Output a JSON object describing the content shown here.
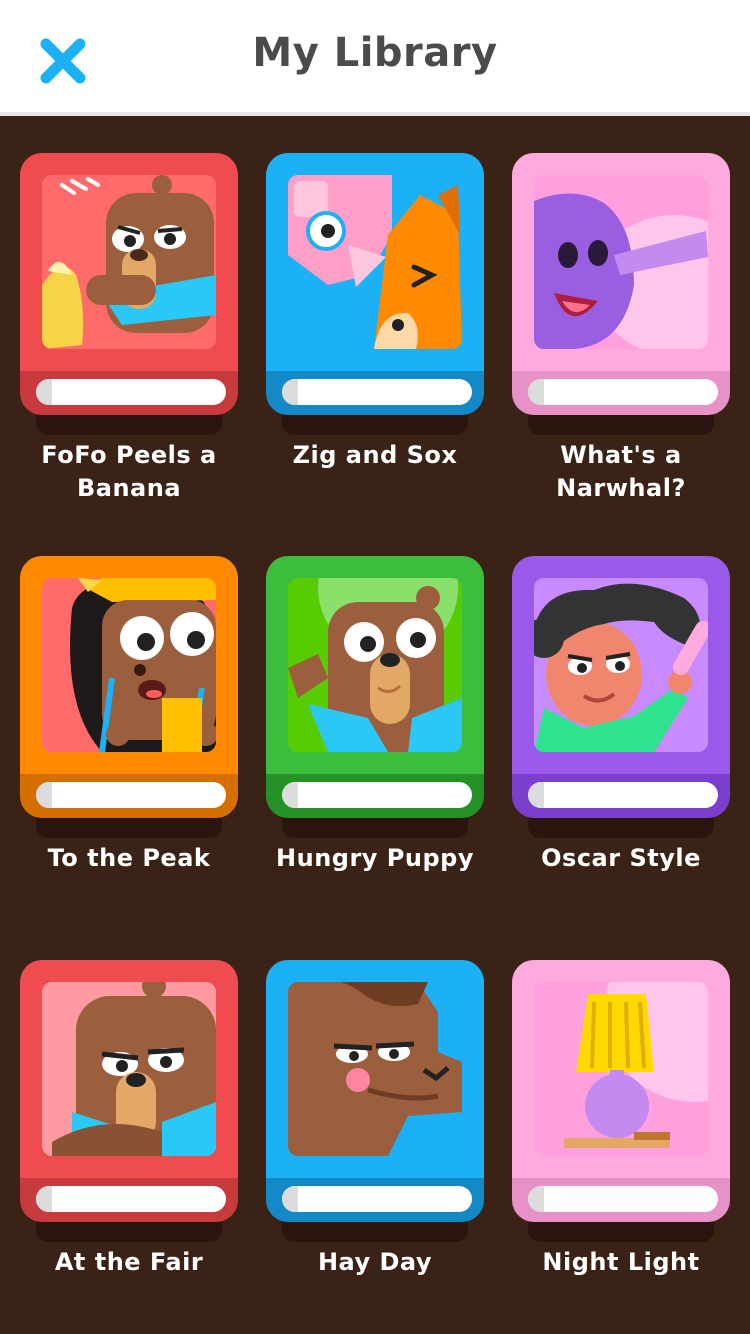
{
  "header": {
    "title": "My Library",
    "close_icon": "close-icon"
  },
  "theme": {
    "background": "#3b2217",
    "title_color": "#4b4b4b",
    "close_color": "#1cb0f6"
  },
  "books": [
    {
      "title": "FoFo Peels a Banana",
      "color": "#ef4c4f",
      "dark": "#c73b3f",
      "icon": "bear-with-banana-icon"
    },
    {
      "title": "Zig and Sox",
      "color": "#1cb0f6",
      "dark": "#1489c8",
      "icon": "pig-and-fox-icon"
    },
    {
      "title": "What's a Narwhal?",
      "color": "#ffaade",
      "dark": "#e890c8",
      "icon": "narwhal-icon"
    },
    {
      "title": "To the Peak",
      "color": "#ff8a00",
      "dark": "#d56f00",
      "icon": "hiker-girl-icon"
    },
    {
      "title": "Hungry Puppy",
      "color": "#3cbd3d",
      "dark": "#249226",
      "icon": "puppy-icon"
    },
    {
      "title": "Oscar Style",
      "color": "#9a59e8",
      "dark": "#7a3fcc",
      "icon": "oscar-hair-icon"
    },
    {
      "title": "At the Fair",
      "color": "#ef4c4f",
      "dark": "#c73b3f",
      "icon": "grumpy-bear-icon"
    },
    {
      "title": "Hay Day",
      "color": "#1cb0f6",
      "dark": "#1489c8",
      "icon": "horse-icon"
    },
    {
      "title": "Night Light",
      "color": "#ffaade",
      "dark": "#e890c8",
      "icon": "lamp-icon"
    }
  ]
}
